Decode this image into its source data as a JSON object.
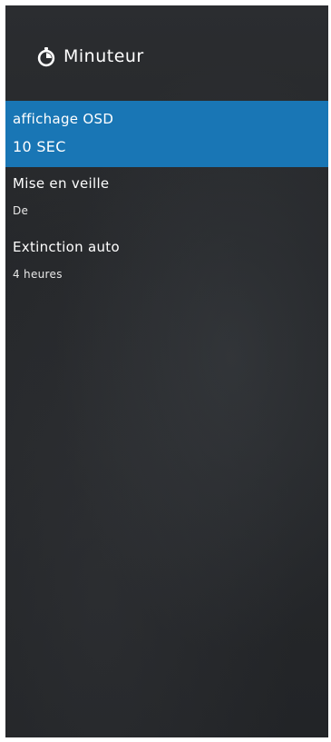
{
  "header": {
    "icon": "stopwatch-icon",
    "title": "Minuteur"
  },
  "menu": {
    "items": [
      {
        "label": "affichage OSD",
        "value": "10 SEC",
        "selected": true
      },
      {
        "label": "Mise en veille",
        "value": "De",
        "selected": false
      },
      {
        "label": "Extinction auto",
        "value": "4 heures",
        "selected": false
      }
    ]
  },
  "colors": {
    "panel_background": "#26282b",
    "selected_background": "#1976b5",
    "text": "#ffffff"
  }
}
